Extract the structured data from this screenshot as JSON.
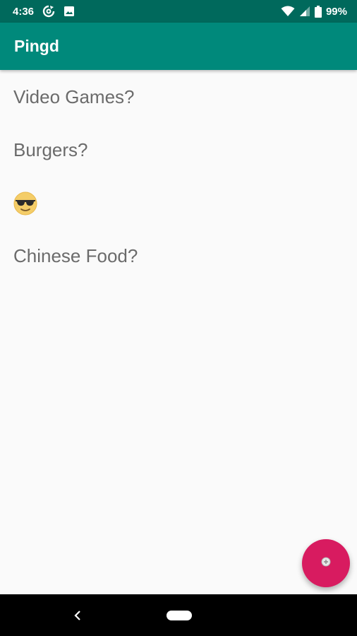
{
  "status_bar": {
    "time": "4:36",
    "battery": "99%",
    "icons": [
      "sync-icon",
      "image-icon",
      "wifi-icon",
      "signal-icon",
      "battery-icon"
    ]
  },
  "app_bar": {
    "title": "Pingd"
  },
  "list": {
    "items": [
      {
        "label": "Video Games?"
      },
      {
        "label": "Burgers?"
      },
      {
        "icon": "sunglasses-emoji-icon"
      },
      {
        "label": "Chinese Food?"
      }
    ]
  },
  "fab": {
    "icon": "add-icon",
    "color": "#d81b60"
  },
  "nav_bar": {
    "icons": [
      "back-icon",
      "home-pill-icon"
    ]
  },
  "colors": {
    "status_bar": "#00695c",
    "app_bar": "#00897b",
    "text": "#6b6b6b",
    "background": "#fafafa",
    "accent": "#d81b60"
  }
}
